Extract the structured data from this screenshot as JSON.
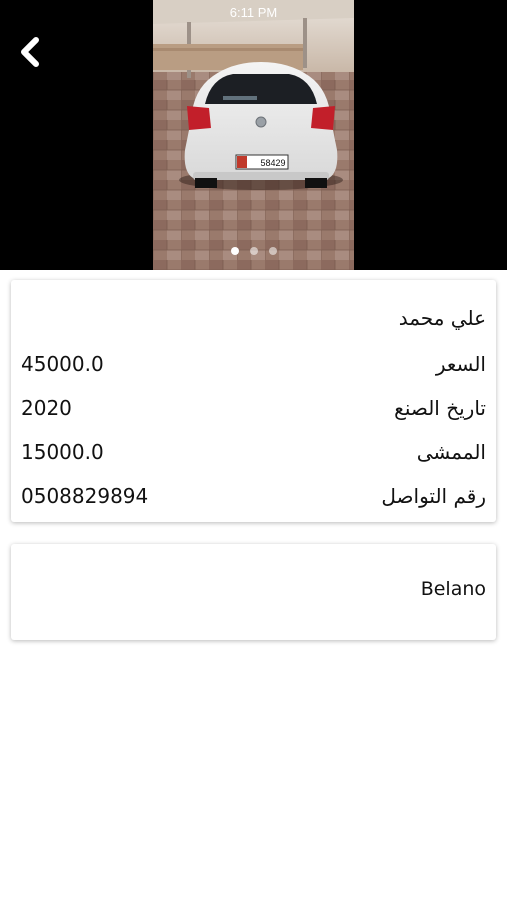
{
  "status_bar": {
    "time": "6:11 PM"
  },
  "header": {
    "back_icon": "chevron-left-icon"
  },
  "gallery": {
    "photo_subject": "white hatchback rear view",
    "plate_number": "58429",
    "dot_count": 3,
    "active_index": 0
  },
  "details": {
    "owner_name": "علي محمد",
    "rows": [
      {
        "label": "السعر",
        "value": "45000.0"
      },
      {
        "label": "تاريخ الصنع",
        "value": "2020"
      },
      {
        "label": "الممشى",
        "value": "15000.0"
      },
      {
        "label": "رقم التواصل",
        "value": "0508829894"
      }
    ]
  },
  "model": {
    "name": "Belano"
  }
}
